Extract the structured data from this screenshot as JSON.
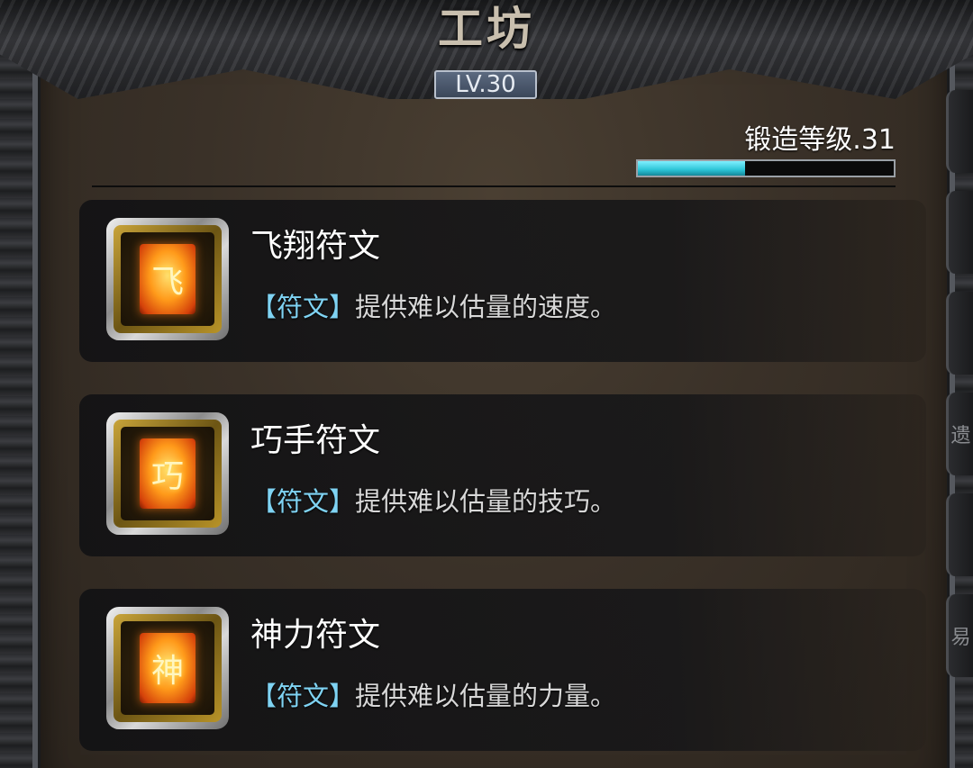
{
  "header": {
    "title": "工坊",
    "level_badge": "LV.30"
  },
  "forge": {
    "label": "锻造等级.31",
    "progress_percent": 42
  },
  "runes": [
    {
      "name": "飞翔符文",
      "tag": "【符文】",
      "description": "提供难以估量的速度。",
      "glyph": "飞"
    },
    {
      "name": "巧手符文",
      "tag": "【符文】",
      "description": "提供难以估量的技巧。",
      "glyph": "巧"
    },
    {
      "name": "神力符文",
      "tag": "【符文】",
      "description": "提供难以估量的力量。",
      "glyph": "神"
    }
  ],
  "side_tabs": [
    "",
    "",
    "",
    "遗",
    "",
    "易"
  ],
  "colors": {
    "accent_cyan": "#2cc4d6",
    "tag_blue": "#7fd3f3",
    "rune_orange": "#ff9a1a"
  }
}
